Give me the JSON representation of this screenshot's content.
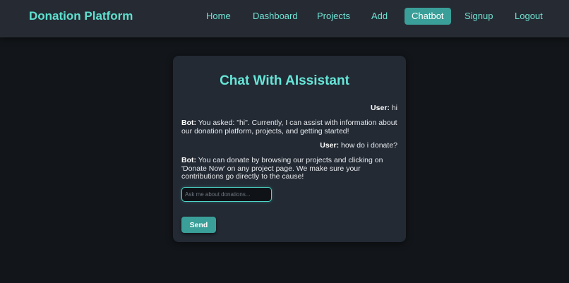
{
  "nav": {
    "brand": "Donation Platform",
    "links": [
      "Home",
      "Dashboard",
      "Projects",
      "Add",
      "Chatbot",
      "Signup",
      "Logout"
    ],
    "active": "Chatbot"
  },
  "chat": {
    "title": "Chat With AIssistant",
    "messages": [
      {
        "speaker": "User:",
        "text": "hi"
      },
      {
        "speaker": "Bot:",
        "text": "You asked: \"hi\". Currently, I can assist with information about our donation platform, projects, and getting started!"
      },
      {
        "speaker": "User:",
        "text": "how do i donate?"
      },
      {
        "speaker": "Bot:",
        "text": "You can donate by browsing our projects and clicking on 'Donate Now' on any project page. We make sure your contributions go directly to the cause!"
      }
    ],
    "input_placeholder": "Ask me about donations...",
    "input_value": "",
    "send_label": "Send"
  },
  "colors": {
    "accent": "#5ee0d0",
    "button": "#3a9f98",
    "navbar": "#262b33",
    "card": "#232a34",
    "background": "#121519"
  }
}
